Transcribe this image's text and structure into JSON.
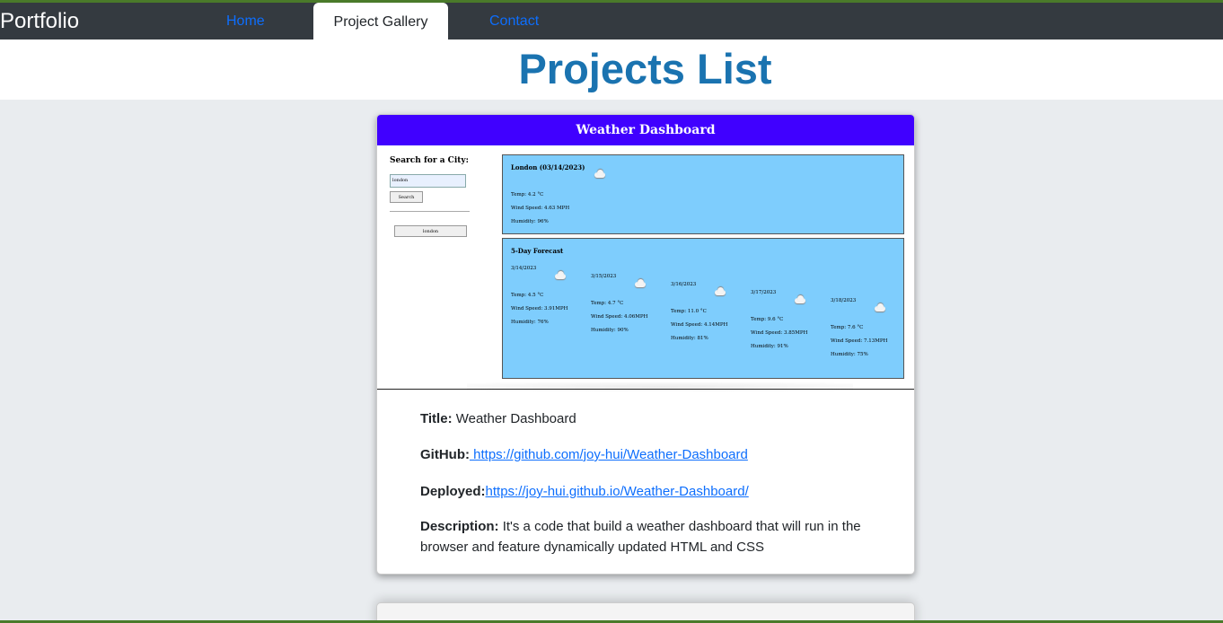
{
  "nav": {
    "brand": "Portfolio",
    "links": [
      {
        "label": "Home"
      },
      {
        "label": "Project Gallery"
      },
      {
        "label": "Contact"
      }
    ]
  },
  "page": {
    "title": "Projects List"
  },
  "project": {
    "screenshot": {
      "app_title": "Weather Dashboard",
      "search_label": "Search for a City:",
      "search_value": "london",
      "search_button": "Search",
      "history_item": "london",
      "today": {
        "heading": "London (03/14/2023)",
        "temp": "Temp: 4.2 °C",
        "wind": "Wind Speed: 4.63 MPH",
        "humidity": "Humidity: 96%"
      },
      "forecast_heading": "5-Day Forecast",
      "forecast": [
        {
          "date": "3/14/2023",
          "temp": "Temp: 4.5 °C",
          "wind": "Wind Speed: 3.91MPH",
          "humidity": "Humidity: 76%"
        },
        {
          "date": "3/15/2023",
          "temp": "Temp: 4.7 °C",
          "wind": "Wind Speed: 4.06MPH",
          "humidity": "Humidity: 90%"
        },
        {
          "date": "3/16/2023",
          "temp": "Temp: 11.0 °C",
          "wind": "Wind Speed: 4.14MPH",
          "humidity": "Humidity: 81%"
        },
        {
          "date": "3/17/2023",
          "temp": "Temp: 9.6 °C",
          "wind": "Wind Speed: 3.85MPH",
          "humidity": "Humidity: 91%"
        },
        {
          "date": "3/18/2023",
          "temp": "Temp: 7.6 °C",
          "wind": "Wind Speed: 7.13MPH",
          "humidity": "Humidity: 75%"
        }
      ]
    },
    "title_label": "Title:",
    "title_value": "Weather Dashboard",
    "github_label": "GitHub:",
    "github_link": " https://github.com/joy-hui/Weather-Dashboard",
    "deployed_label": "Deployed:",
    "deployed_link": "https://joy-hui.github.io/Weather-Dashboard/",
    "description_label": "Description:",
    "description_value": "It's a code that build a weather dashboard that will run in the browser and feature dynamically updated HTML and CSS"
  }
}
